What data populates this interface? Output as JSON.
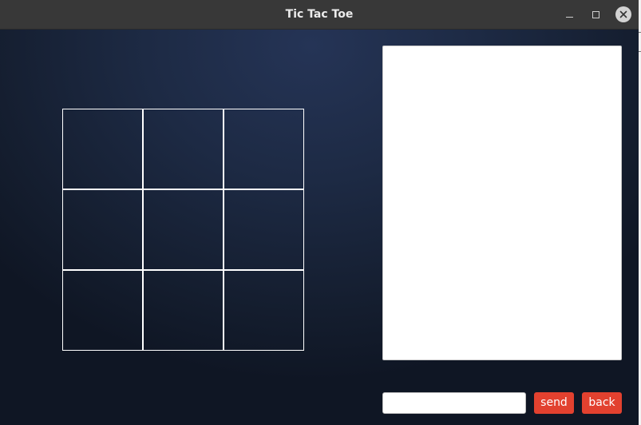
{
  "window": {
    "title": "Tic Tac Toe",
    "controls": {
      "minimize_icon": "minimize-icon",
      "maximize_icon": "maximize-icon",
      "close_icon": "close-icon"
    }
  },
  "board": {
    "cells": [
      "",
      "",
      "",
      "",
      "",
      "",
      "",
      "",
      ""
    ]
  },
  "chat": {
    "messages": [],
    "input_value": "",
    "send_label": "send",
    "back_label": "back"
  },
  "colors": {
    "button_accent": "#e2412f",
    "grid_line": "#ffffff",
    "background": "#1d2a44"
  }
}
